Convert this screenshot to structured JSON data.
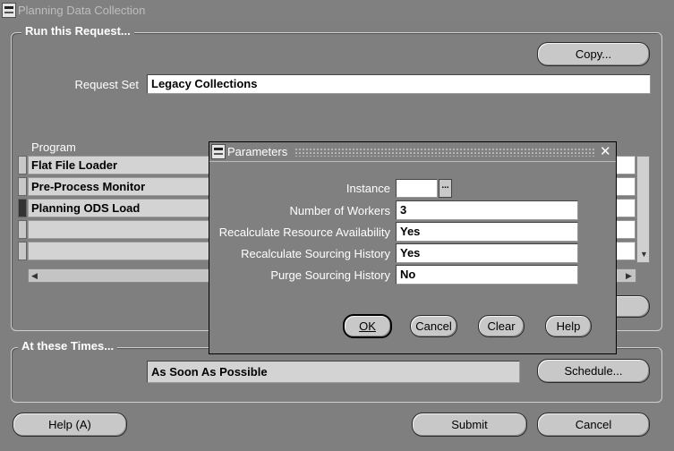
{
  "window": {
    "title": "Planning Data Collection"
  },
  "run_group": {
    "legend": "Run this Request...",
    "copy_button": "Copy...",
    "request_set_label": "Request Set",
    "request_set_value": "Legacy Collections",
    "program_column_header": "Program",
    "programs": [
      "Flat File Loader",
      "Pre-Process Monitor",
      "Planning ODS Load",
      "",
      ""
    ]
  },
  "times_group": {
    "legend": "At these Times...",
    "schedule_value": "As Soon As Possible",
    "schedule_button": "Schedule..."
  },
  "bottom_buttons": {
    "help": "Help (A)",
    "submit": "Submit",
    "cancel": "Cancel"
  },
  "dialog": {
    "title": "Parameters",
    "close_glyph": "✕",
    "params": [
      {
        "label": "Instance",
        "value": ""
      },
      {
        "label": "Number of Workers",
        "value": "3"
      },
      {
        "label": "Recalculate Resource Availability",
        "value": "Yes"
      },
      {
        "label": "Recalculate Sourcing History",
        "value": "Yes"
      },
      {
        "label": "Purge Sourcing History",
        "value": "No"
      }
    ],
    "lov_button": "...",
    "buttons": {
      "ok": "OK",
      "cancel": "Cancel",
      "clear": "Clear",
      "help": "Help"
    }
  },
  "colors": {
    "background": "#7f7f7f",
    "button": "#c8c8c8",
    "field": "#ffffff",
    "readonly_field": "#d3d3d3"
  }
}
